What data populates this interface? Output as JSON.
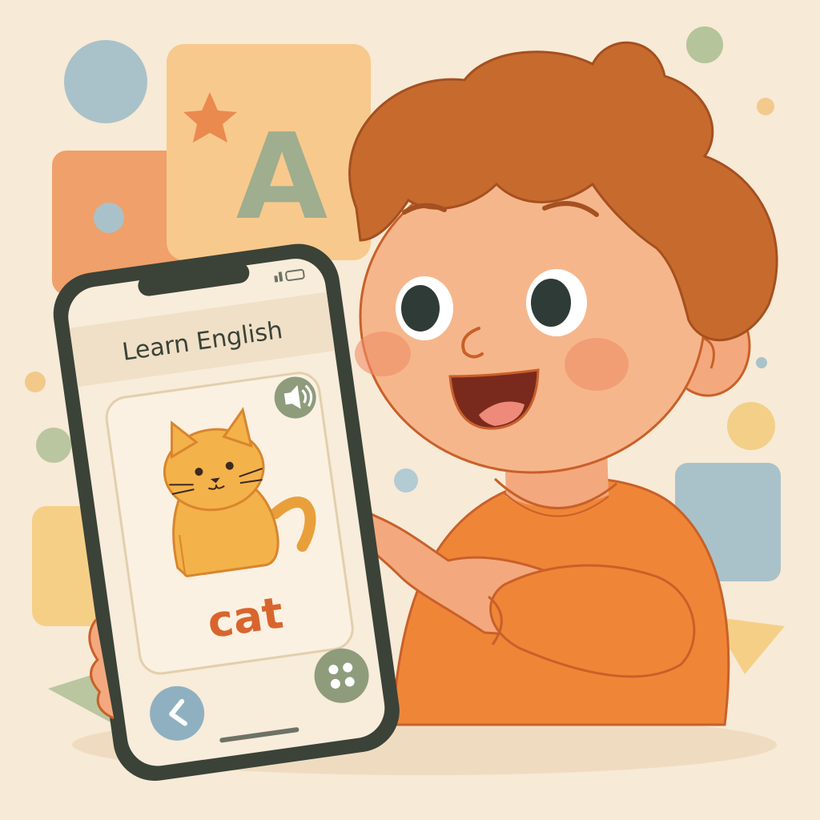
{
  "app": {
    "header_title": "Learn English",
    "flashcard": {
      "word": "cat",
      "image": "cat-illustration"
    },
    "buttons": {
      "sound": "speaker-icon",
      "back": "chevron-left-icon",
      "menu": "grid-dots-icon"
    }
  },
  "decor": {
    "letter_block": "A"
  },
  "colors": {
    "background": "#f7ead6",
    "accent_orange": "#e9803a",
    "word_color": "#d9652e",
    "button_green": "#8e9c7c",
    "button_blue": "#8fb0c0",
    "phone_frame": "#3b4238"
  }
}
